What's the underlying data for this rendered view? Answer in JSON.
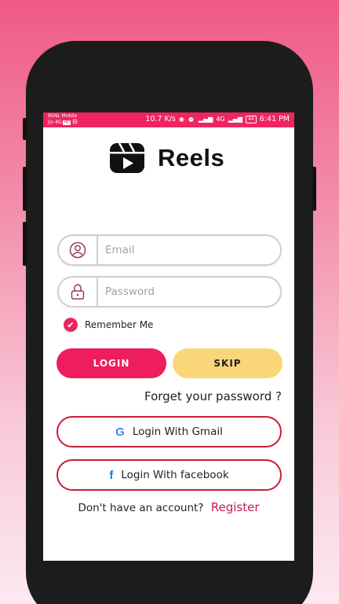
{
  "status_bar": {
    "carrier_1": "BSNL Mobile",
    "carrier_2": "Jio 4G",
    "hd_badge": "HD",
    "net_speed": "10.7 K/s",
    "signal": "4G",
    "battery": "44",
    "time": "6:41 PM"
  },
  "app": {
    "name": "Reels"
  },
  "form": {
    "email_placeholder": "Email",
    "password_placeholder": "Password",
    "remember_label": "Remember Me",
    "remember_checked": true,
    "login_label": "LOGIN",
    "skip_label": "SKIP",
    "forgot_label": "Forget your password ?"
  },
  "social": {
    "gmail_label": "Login With Gmail",
    "facebook_label": "Login With facebook"
  },
  "footer": {
    "prompt": "Don't have an account?",
    "register_label": "Register"
  },
  "colors": {
    "accent": "#ee2560",
    "skip": "#f9d678",
    "social_border": "#c51d3a",
    "register": "#c8175a"
  },
  "icons": [
    "user-icon",
    "lock-icon",
    "check-icon",
    "google-icon",
    "facebook-icon",
    "reels-logo-icon"
  ]
}
